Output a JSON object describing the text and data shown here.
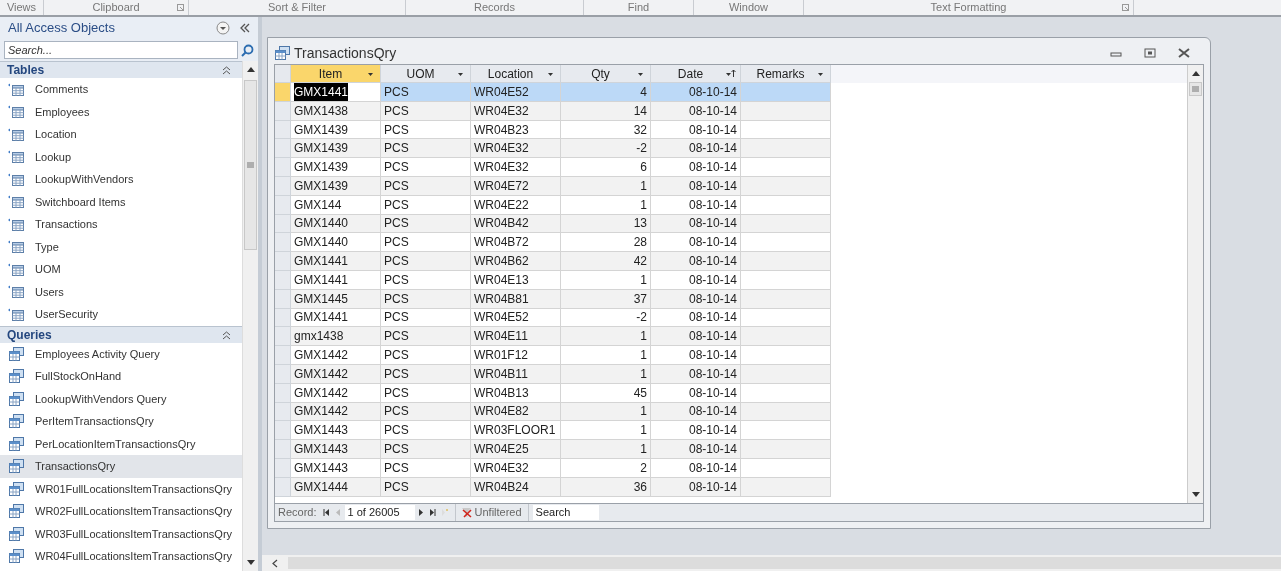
{
  "ribbon_groups": [
    {
      "label": "Views",
      "has_launcher": false
    },
    {
      "label": "Clipboard",
      "has_launcher": true
    },
    {
      "label": "Sort & Filter",
      "has_launcher": false
    },
    {
      "label": "Records",
      "has_launcher": false
    },
    {
      "label": "Find",
      "has_launcher": false
    },
    {
      "label": "Window",
      "has_launcher": false
    },
    {
      "label": "Text Formatting",
      "has_launcher": true
    }
  ],
  "navigation_pane": {
    "title": "All Access Objects",
    "search": {
      "placeholder": "Search..."
    },
    "groups": [
      {
        "title": "Tables",
        "expanded": true,
        "items": [
          {
            "label": "Comments",
            "kind": "table",
            "selected": false
          },
          {
            "label": "Employees",
            "kind": "table",
            "selected": false
          },
          {
            "label": "Location",
            "kind": "table",
            "selected": false
          },
          {
            "label": "Lookup",
            "kind": "table",
            "selected": false
          },
          {
            "label": "LookupWithVendors",
            "kind": "table",
            "selected": false
          },
          {
            "label": "Switchboard Items",
            "kind": "table",
            "selected": false
          },
          {
            "label": "Transactions",
            "kind": "table",
            "selected": false
          },
          {
            "label": "Type",
            "kind": "table",
            "selected": false
          },
          {
            "label": "UOM",
            "kind": "table",
            "selected": false
          },
          {
            "label": "Users",
            "kind": "table",
            "selected": false
          },
          {
            "label": "UserSecurity",
            "kind": "table",
            "selected": false
          }
        ]
      },
      {
        "title": "Queries",
        "expanded": true,
        "items": [
          {
            "label": "Employees Activity Query",
            "kind": "query",
            "selected": false
          },
          {
            "label": "FullStockOnHand",
            "kind": "query",
            "selected": false
          },
          {
            "label": "LookupWithVendors Query",
            "kind": "query",
            "selected": false
          },
          {
            "label": "PerItemTransactionsQry",
            "kind": "query",
            "selected": false
          },
          {
            "label": "PerLocationItemTransactionsQry",
            "kind": "query",
            "selected": false
          },
          {
            "label": "TransactionsQry",
            "kind": "query",
            "selected": true
          },
          {
            "label": "WR01FullLocationsItemTransactionsQry",
            "kind": "query",
            "selected": false
          },
          {
            "label": "WR02FullLocationsItemTransactionsQry",
            "kind": "query",
            "selected": false
          },
          {
            "label": "WR03FullLocationsItemTransactionsQry",
            "kind": "query",
            "selected": false
          },
          {
            "label": "WR04FullLocationsItemTransactionsQry",
            "kind": "query",
            "selected": false
          }
        ]
      }
    ]
  },
  "document": {
    "title": "TransactionsQry",
    "columns": [
      {
        "label": "Item",
        "kind": "text",
        "selected": true,
        "sorted": false
      },
      {
        "label": "UOM",
        "kind": "text",
        "selected": false,
        "sorted": false
      },
      {
        "label": "Location",
        "kind": "text",
        "selected": false,
        "sorted": false
      },
      {
        "label": "Qty",
        "kind": "number",
        "selected": false,
        "sorted": false
      },
      {
        "label": "Date",
        "kind": "number",
        "selected": false,
        "sorted": true
      },
      {
        "label": "Remarks",
        "kind": "text",
        "selected": false,
        "sorted": false
      }
    ],
    "rows": [
      {
        "selected": true,
        "cells": [
          "GMX1441",
          "PCS",
          "WR04E52",
          "4",
          "08-10-14"
        ]
      },
      {
        "selected": false,
        "cells": [
          "GMX1438",
          "PCS",
          "WR04E32",
          "14",
          "08-10-14"
        ]
      },
      {
        "selected": false,
        "cells": [
          "GMX1439",
          "PCS",
          "WR04B23",
          "32",
          "08-10-14"
        ]
      },
      {
        "selected": false,
        "cells": [
          "GMX1439",
          "PCS",
          "WR04E32",
          "-2",
          "08-10-14"
        ]
      },
      {
        "selected": false,
        "cells": [
          "GMX1439",
          "PCS",
          "WR04E32",
          "6",
          "08-10-14"
        ]
      },
      {
        "selected": false,
        "cells": [
          "GMX1439",
          "PCS",
          "WR04E72",
          "1",
          "08-10-14"
        ]
      },
      {
        "selected": false,
        "cells": [
          "GMX144",
          "PCS",
          "WR04E22",
          "1",
          "08-10-14"
        ]
      },
      {
        "selected": false,
        "cells": [
          "GMX1440",
          "PCS",
          "WR04B42",
          "13",
          "08-10-14"
        ]
      },
      {
        "selected": false,
        "cells": [
          "GMX1440",
          "PCS",
          "WR04B72",
          "28",
          "08-10-14"
        ]
      },
      {
        "selected": false,
        "cells": [
          "GMX1441",
          "PCS",
          "WR04B62",
          "42",
          "08-10-14"
        ]
      },
      {
        "selected": false,
        "cells": [
          "GMX1441",
          "PCS",
          "WR04E13",
          "1",
          "08-10-14"
        ]
      },
      {
        "selected": false,
        "cells": [
          "GMX1445",
          "PCS",
          "WR04B81",
          "37",
          "08-10-14"
        ]
      },
      {
        "selected": false,
        "cells": [
          "GMX1441",
          "PCS",
          "WR04E52",
          "-2",
          "08-10-14"
        ]
      },
      {
        "selected": false,
        "cells": [
          "gmx1438",
          "PCS",
          "WR04E11",
          "1",
          "08-10-14"
        ]
      },
      {
        "selected": false,
        "cells": [
          "GMX1442",
          "PCS",
          "WR01F12",
          "1",
          "08-10-14"
        ]
      },
      {
        "selected": false,
        "cells": [
          "GMX1442",
          "PCS",
          "WR04B11",
          "1",
          "08-10-14"
        ]
      },
      {
        "selected": false,
        "cells": [
          "GMX1442",
          "PCS",
          "WR04B13",
          "45",
          "08-10-14"
        ]
      },
      {
        "selected": false,
        "cells": [
          "GMX1442",
          "PCS",
          "WR04E82",
          "1",
          "08-10-14"
        ]
      },
      {
        "selected": false,
        "cells": [
          "GMX1443",
          "PCS",
          "WR03FLOOR1",
          "1",
          "08-10-14"
        ]
      },
      {
        "selected": false,
        "cells": [
          "GMX1443",
          "PCS",
          "WR04E25",
          "1",
          "08-10-14"
        ]
      },
      {
        "selected": false,
        "cells": [
          "GMX1443",
          "PCS",
          "WR04E32",
          "2",
          "08-10-14"
        ]
      },
      {
        "selected": false,
        "cells": [
          "GMX1444",
          "PCS",
          "WR04B24",
          "36",
          "08-10-14"
        ]
      }
    ],
    "record_navigator": {
      "label": "Record:",
      "position": "1 of 26005",
      "filter": "Unfiltered",
      "search": {
        "placeholder": "Search"
      }
    }
  }
}
